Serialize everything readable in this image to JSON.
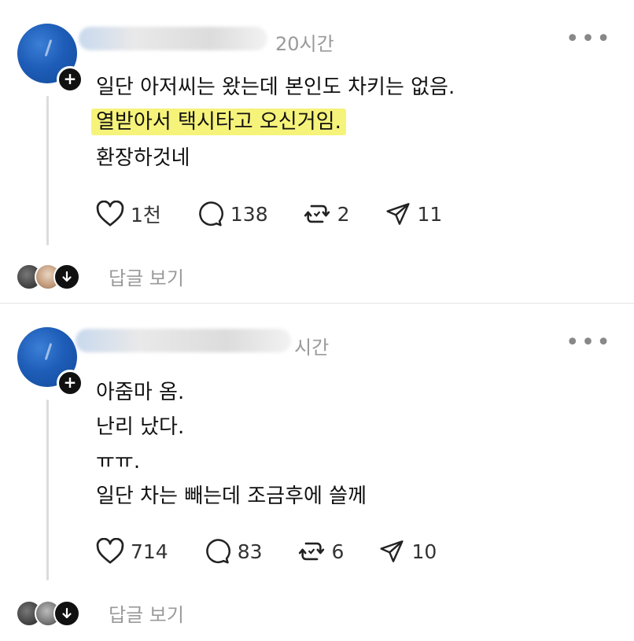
{
  "posts": [
    {
      "time": "20시간",
      "more": "•••",
      "lines": [
        "일단 아저씨는 왔는데 본인도 차키는 없음.",
        "열받아서 택시타고 오신거임.",
        "환장하것네"
      ],
      "highlight_color": "#f6f37a",
      "likes": "1천",
      "comments": "138",
      "reposts": "2",
      "shares": "11",
      "view_replies": "답글 보기"
    },
    {
      "time": "시간",
      "more": "•••",
      "lines": [
        "아줌마 옴.",
        "난리 났다.",
        "ㅠㅠ.",
        "일단 차는 빼는데 조금후에 쓸께"
      ],
      "likes": "714",
      "comments": "83",
      "reposts": "6",
      "shares": "10",
      "view_replies": "답글 보기"
    }
  ],
  "icons": {
    "heart": "heart-icon",
    "comment": "comment-icon",
    "repost": "repost-icon",
    "share": "share-icon",
    "plus": "plus-icon",
    "down": "arrow-down-icon",
    "more": "more-icon"
  }
}
